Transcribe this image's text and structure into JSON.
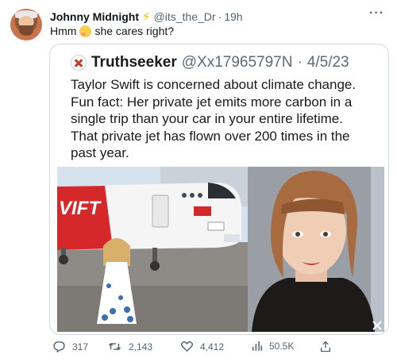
{
  "tweet": {
    "author_name": "Johnny Midnight",
    "badge_icon": "lightning-icon",
    "handle": "@its_the_Dr",
    "separator": "·",
    "time": "19h",
    "text_before": "Hmm",
    "emoji": "thinking-face-emoji",
    "text_after": "she cares right?"
  },
  "quoted_screenshot": {
    "author_name": "Truthseeker",
    "handle": "@Xx17965797N",
    "separator": "·",
    "date": "4/5/23",
    "lines": [
      "Taylor Swift is concerned about climate change.",
      "Fun fact: Her private jet emits more carbon in a",
      "single trip than your car in your entire lifetime.",
      "That private jet has flown over 200 times in the",
      "past year."
    ],
    "plane_text": "VIFT"
  },
  "actions": {
    "replies": "317",
    "retweets": "2,143",
    "likes": "4,412",
    "views": "50.5K"
  },
  "colors": {
    "text": "#0f1419",
    "muted": "#536471",
    "border": "#cfd9de",
    "plane_red": "#d5282a"
  }
}
